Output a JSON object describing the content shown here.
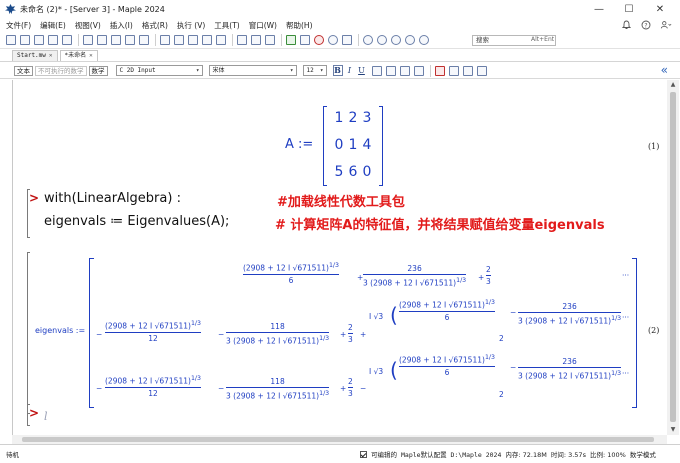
{
  "window": {
    "title": "未命名 (2)* - [Server 3] - Maple 2024",
    "controls": {
      "minimize": "—",
      "maximize": "☐",
      "close": "✕"
    }
  },
  "menu": {
    "items": [
      "文件(F)",
      "编辑(E)",
      "视图(V)",
      "插入(I)",
      "格式(R)",
      "执行 (V)",
      "工具(T)",
      "窗口(W)",
      "帮助(H)"
    ],
    "right_icons": [
      "bell-icon",
      "help-icon",
      "user-icon"
    ]
  },
  "toolbar": {
    "search_placeholder": "搜索",
    "search_shortcut": "Alt+Ent"
  },
  "tabs": [
    {
      "label": "Start.mw",
      "active": false
    },
    {
      "label": "*未命名",
      "active": true
    }
  ],
  "context_bar": {
    "mode_text": "文本",
    "mode_nonexec": "不可执行的数学",
    "mode_math": "数学",
    "style": "C  2D Input",
    "font": "宋体",
    "size": "12",
    "format_buttons": [
      "B",
      "I",
      "U"
    ]
  },
  "document": {
    "matrix_label": "A :=",
    "matrix": [
      [
        "1",
        "2",
        "3"
      ],
      [
        "0",
        "1",
        "4"
      ],
      [
        "5",
        "6",
        "0"
      ]
    ],
    "eq1_number": "(1)",
    "prompt": ">",
    "cmd1": "with(LinearAlgebra) :",
    "comment1": "#加载线性代数工具包",
    "cmd2": "eigenvals ≔ Eigenvalues(A);",
    "comment2": "# 计算矩阵A的特征值，并将结果赋值给变量eigenvals",
    "result_label": "eigenvals :=",
    "eq2_number": "(2)",
    "result_parts": {
      "cube_root_expr": "(2908 + 12 I √671511)",
      "exp_third": "1/3",
      "den_6": "6",
      "den_12": "12",
      "num_236": "236",
      "num_118": "118",
      "den_3_expr": "3 (2908 + 12 I √671511)",
      "two_thirds_num": "2",
      "two_thirds_den": "3",
      "plus": "+",
      "minus": "−",
      "ellipsis": "···",
      "i_sqrt3": "I √3",
      "den_2": "2"
    },
    "next_prompt": ">",
    "cursor_glyph": "l"
  },
  "status": {
    "ready": "待机",
    "editable_label": "可编辑的",
    "info": "Maple默认配置  D:\\Maple 2024",
    "memory": "内存: 72.18M",
    "time": "时间: 3.57s",
    "zoom": "比例: 100%",
    "mode": "数学模式",
    "editable_checked": true
  }
}
